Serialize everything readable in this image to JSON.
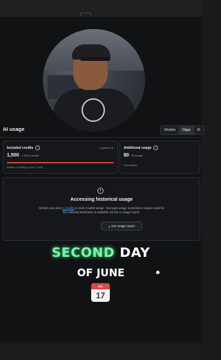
{
  "section_title": "AI usage",
  "tabs": [
    "Models",
    "Days",
    "M"
  ],
  "included_credits": {
    "label": "Included credits",
    "tag": "Copilot Pro",
    "value": "1,500",
    "sub": "/ 1,500 AI credits",
    "progress_fraction": 1.0,
    "note": "Resets in 29 days on Jul 1, 2026"
  },
  "additional_usage": {
    "label": "Additional usage",
    "value": "$0",
    "sub": "/ $0 budget",
    "note": "Not enabled"
  },
  "history": {
    "title": "Accessing historical usage",
    "desc_before": "GitHub now uses ",
    "desc_link": "AI credits",
    "desc_after": " to track Copilot usage. Your past usage in premium request units for the selected timeframe is available via the AI usage report.",
    "button": "Get usage report"
  },
  "caption": {
    "green": "SECOND",
    "white": "DAY",
    "line2": "OF JUNE"
  },
  "calendar": {
    "month": "JUL",
    "day": "17"
  },
  "colors": {
    "progress": "#d2433d",
    "caption_green": "#7af5a6",
    "link": "#5aa0ff"
  }
}
